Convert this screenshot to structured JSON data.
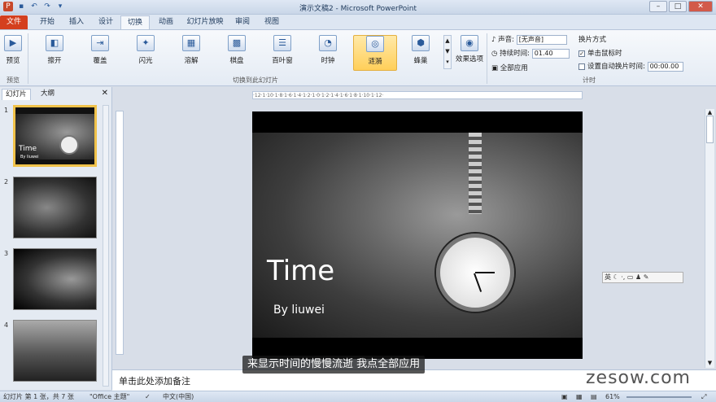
{
  "window": {
    "title": "演示文稿2 - Microsoft PowerPoint"
  },
  "tabs": [
    "文件",
    "开始",
    "插入",
    "设计",
    "切换",
    "动画",
    "幻灯片放映",
    "审阅",
    "视图"
  ],
  "ribbon": {
    "preview_label": "预览",
    "preview_group": "预览",
    "transitions": [
      "擦开",
      "覆盖",
      "闪光",
      "溶解",
      "棋盘",
      "百叶窗",
      "时钟",
      "涟漪",
      "蜂巢"
    ],
    "transition_group": "切换到此幻灯片",
    "effect_options": "效果选项",
    "sound_label": "声音:",
    "sound_value": "[无声音]",
    "duration_label": "持续时间:",
    "duration_value": "01.40",
    "apply_all": "全部应用",
    "advance_title": "换片方式",
    "on_click": "单击鼠标时",
    "auto_after": "设置自动换片时间:",
    "auto_value": "00:00.00",
    "timing_group": "计时"
  },
  "left_pane": {
    "tab_slides": "幻灯片",
    "tab_outline": "大纲",
    "slide_numbers": [
      "1",
      "2",
      "3",
      "4"
    ],
    "thumb1_title": "Time",
    "thumb1_sub": "By liuwei"
  },
  "slide": {
    "title": "Time",
    "subtitle": "By liuwei"
  },
  "notes": {
    "placeholder": "单击此处添加备注"
  },
  "video_subtitle": "来显示时间的慢慢流逝 我点全部应用",
  "watermark": "zesow.com",
  "statusbar": {
    "slide_info": "幻灯片 第 1 张，共 7 张",
    "theme": "\"Office 主题\"",
    "lang": "中文(中国)",
    "zoom": "61%"
  },
  "ime": {
    "label": "英"
  }
}
